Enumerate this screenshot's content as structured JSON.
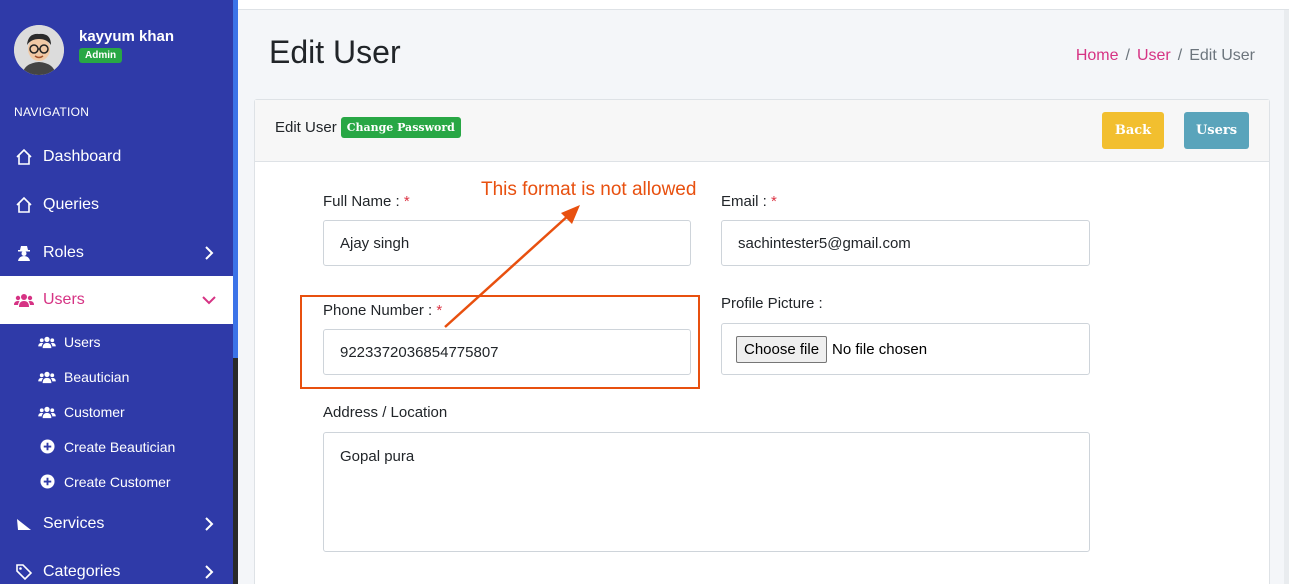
{
  "user": {
    "name": "kayyum khan",
    "role": "Admin"
  },
  "nav": {
    "header": "NAVIGATION",
    "items": [
      {
        "label": "Dashboard",
        "icon": "home-icon"
      },
      {
        "label": "Queries",
        "icon": "home-icon"
      },
      {
        "label": "Roles",
        "icon": "user-secret-icon"
      },
      {
        "label": "Users",
        "icon": "users-icon",
        "active": true
      }
    ],
    "sub_items": [
      {
        "label": "Users",
        "icon": "users-icon"
      },
      {
        "label": "Beautician",
        "icon": "users-icon"
      },
      {
        "label": "Customer",
        "icon": "users-icon"
      },
      {
        "label": "Create Beautician",
        "icon": "plus-circle-icon"
      },
      {
        "label": "Create Customer",
        "icon": "plus-circle-icon"
      }
    ],
    "bottom_items": [
      {
        "label": "Services",
        "icon": "slice-icon"
      },
      {
        "label": "Categories",
        "icon": "tags-icon"
      }
    ]
  },
  "page": {
    "title": "Edit User",
    "breadcrumb": {
      "home": "Home",
      "sep1": "/",
      "section": "User",
      "sep2": "/",
      "current": "Edit User"
    }
  },
  "card": {
    "title": "Edit User",
    "change_password": "Change Password",
    "back_label": "Back",
    "users_label": "Users"
  },
  "form": {
    "full_name_label": "Full Name :",
    "full_name_value": "Ajay singh",
    "email_label": "Email :",
    "email_value": "sachintester5@gmail.com",
    "phone_label": "Phone Number :",
    "phone_value": "9223372036854775807",
    "profile_label": "Profile Picture :",
    "file_button": "Choose file",
    "file_status": "No file chosen",
    "address_label": "Address / Location",
    "address_value": "Gopal pura",
    "required_mark": "*"
  },
  "annotation": {
    "text": "This format is not allowed"
  },
  "colors": {
    "sidebar": "#2f3aa8",
    "accent_pink": "#d63384",
    "success": "#28a745",
    "warning": "#f2bf2f",
    "info": "#5aa4bb",
    "annotation": "#e8500f"
  }
}
